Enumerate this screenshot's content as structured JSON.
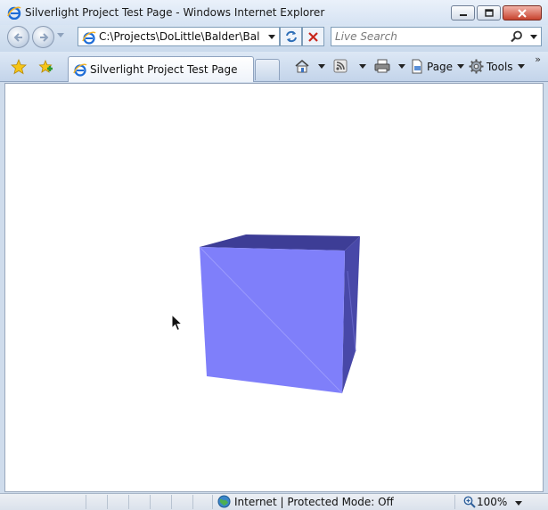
{
  "window": {
    "title": "Silverlight Project Test Page - Windows Internet Explorer"
  },
  "address_bar": {
    "url": "C:\\Projects\\DoLittle\\Balder\\Balder\\"
  },
  "search": {
    "placeholder": "Live Search"
  },
  "tabs": [
    {
      "label": "Silverlight Project Test Page",
      "active": true
    }
  ],
  "command_bar": {
    "page_label": "Page",
    "tools_label": "Tools"
  },
  "status_bar": {
    "zone_text": "Internet | Protected Mode: Off",
    "zoom_text": "100%"
  },
  "scene": {
    "front_face_color": "#7f7ffa",
    "top_face_color": "#3d3d96",
    "side_face_color": "#4848a8"
  },
  "icons": {
    "title": "ie-logo-icon",
    "back": "back-arrow-icon",
    "forward": "forward-arrow-icon",
    "refresh": "refresh-icon",
    "stop": "stop-icon",
    "search": "search-icon",
    "favorites": "favorites-star-icon",
    "add_favorite": "add-favorite-icon",
    "home": "home-icon",
    "feeds": "rss-feed-icon",
    "print": "print-icon",
    "page": "page-icon",
    "tools": "gear-icon",
    "zone": "globe-icon",
    "zoom": "zoom-icon"
  }
}
